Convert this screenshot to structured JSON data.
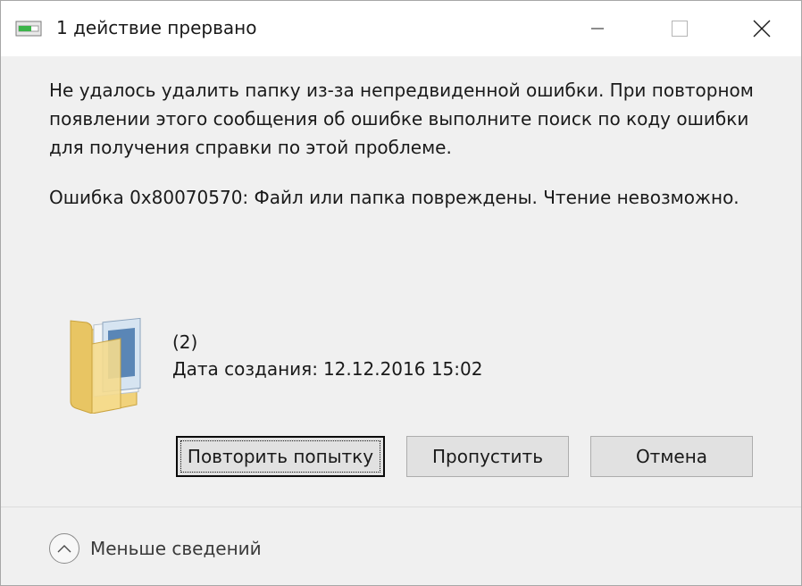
{
  "window": {
    "title": "1 действие прервано"
  },
  "message": {
    "main": "Не удалось удалить папку из-за непредвиденной ошибки. При повторном появлении этого сообщения об ошибке выполните поиск по коду ошибки для получения справки по этой проблеме.",
    "error": "Ошибка 0x80070570: Файл или папка повреждены. Чтение невозможно."
  },
  "file": {
    "name": "(2)",
    "created_label": "Дата создания:",
    "created_value": "12.12.2016 15:02",
    "icon": "folder-icon"
  },
  "buttons": {
    "retry": "Повторить попытку",
    "skip": "Пропустить",
    "cancel": "Отмена"
  },
  "footer": {
    "details_label": "Меньше сведений",
    "icon": "chevron-up-icon"
  },
  "colors": {
    "window_bg": "#f0f0f0",
    "button_bg": "#e1e1e1",
    "button_border": "#adadad"
  }
}
